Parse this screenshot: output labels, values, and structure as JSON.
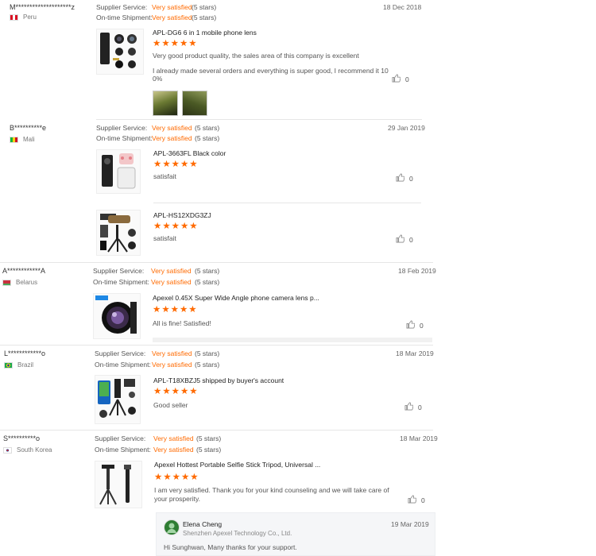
{
  "labels": {
    "supplier_service": "Supplier Service:",
    "ontime_shipment": "On-time Shipment:"
  },
  "colors": {
    "accent": "#ff6a00"
  },
  "reviews": [
    {
      "buyer": "M********************z",
      "country": "Peru",
      "supplier_value": "Very satisfied",
      "supplier_stars": "(5 stars)",
      "shipment_value": "Very satisfied",
      "shipment_stars": "(5 stars)",
      "date": "18 Dec 2018",
      "products": [
        {
          "name": "APL-DG6 6 in 1 mobile phone lens",
          "rating": 5,
          "comment_1": "Very good product quality, the sales area of this company is excellent",
          "comment_2": "I already made several orders and everything is super good, I recommend it 10",
          "comment_3": "0%",
          "likes": "0"
        }
      ]
    },
    {
      "buyer": "B**********e",
      "country": "Mali",
      "supplier_value": "Very satisfied",
      "supplier_stars": "(5 stars)",
      "shipment_value": "Very satisfied",
      "shipment_stars": "(5 stars)",
      "date": "29 Jan 2019",
      "products": [
        {
          "name": "APL-3663FL Black color",
          "rating": 5,
          "comment": "satisfait",
          "likes": "0"
        },
        {
          "name": "APL-HS12XDG3ZJ",
          "rating": 5,
          "comment": "satisfait",
          "likes": "0"
        }
      ]
    },
    {
      "buyer": "A************A",
      "country": "Belarus",
      "supplier_value": "Very satisfied",
      "supplier_stars": "(5 stars)",
      "shipment_value": "Very satisfied",
      "shipment_stars": "(5 stars)",
      "date": "18 Feb 2019",
      "products": [
        {
          "name": "Apexel 0.45X Super Wide Angle phone camera lens p...",
          "rating": 5,
          "comment": "All is fine! Satisfied!",
          "likes": "0"
        }
      ]
    },
    {
      "buyer": "L************o",
      "country": "Brazil",
      "supplier_value": "Very satisfied",
      "supplier_stars": "(5 stars)",
      "shipment_value": "Very satisfied",
      "shipment_stars": "(5 stars)",
      "date": "18 Mar 2019",
      "products": [
        {
          "name": "APL-T18XBZJ5 shipped by buyer's account",
          "rating": 5,
          "comment": "Good seller",
          "likes": "0"
        }
      ]
    },
    {
      "buyer": "S**********o",
      "country": "South Korea",
      "supplier_value": "Very satisfied",
      "supplier_stars": "(5 stars)",
      "shipment_value": "Very satisfied",
      "shipment_stars": "(5 stars)",
      "date": "18 Mar 2019",
      "products": [
        {
          "name": "Apexel Hottest Portable Selfie Stick Tripod, Universal ...",
          "rating": 5,
          "comment_1": "I am very satisfied. Thank you for your kind counseling and we will take care of",
          "comment_2": "your prosperity.",
          "likes": "0"
        }
      ],
      "reply": {
        "name": "Elena Cheng",
        "company": "Shenzhen Apexel Technology Co., Ltd.",
        "date": "19 Mar 2019",
        "text": "Hi Sunghwan, Many thanks for your support."
      }
    }
  ]
}
